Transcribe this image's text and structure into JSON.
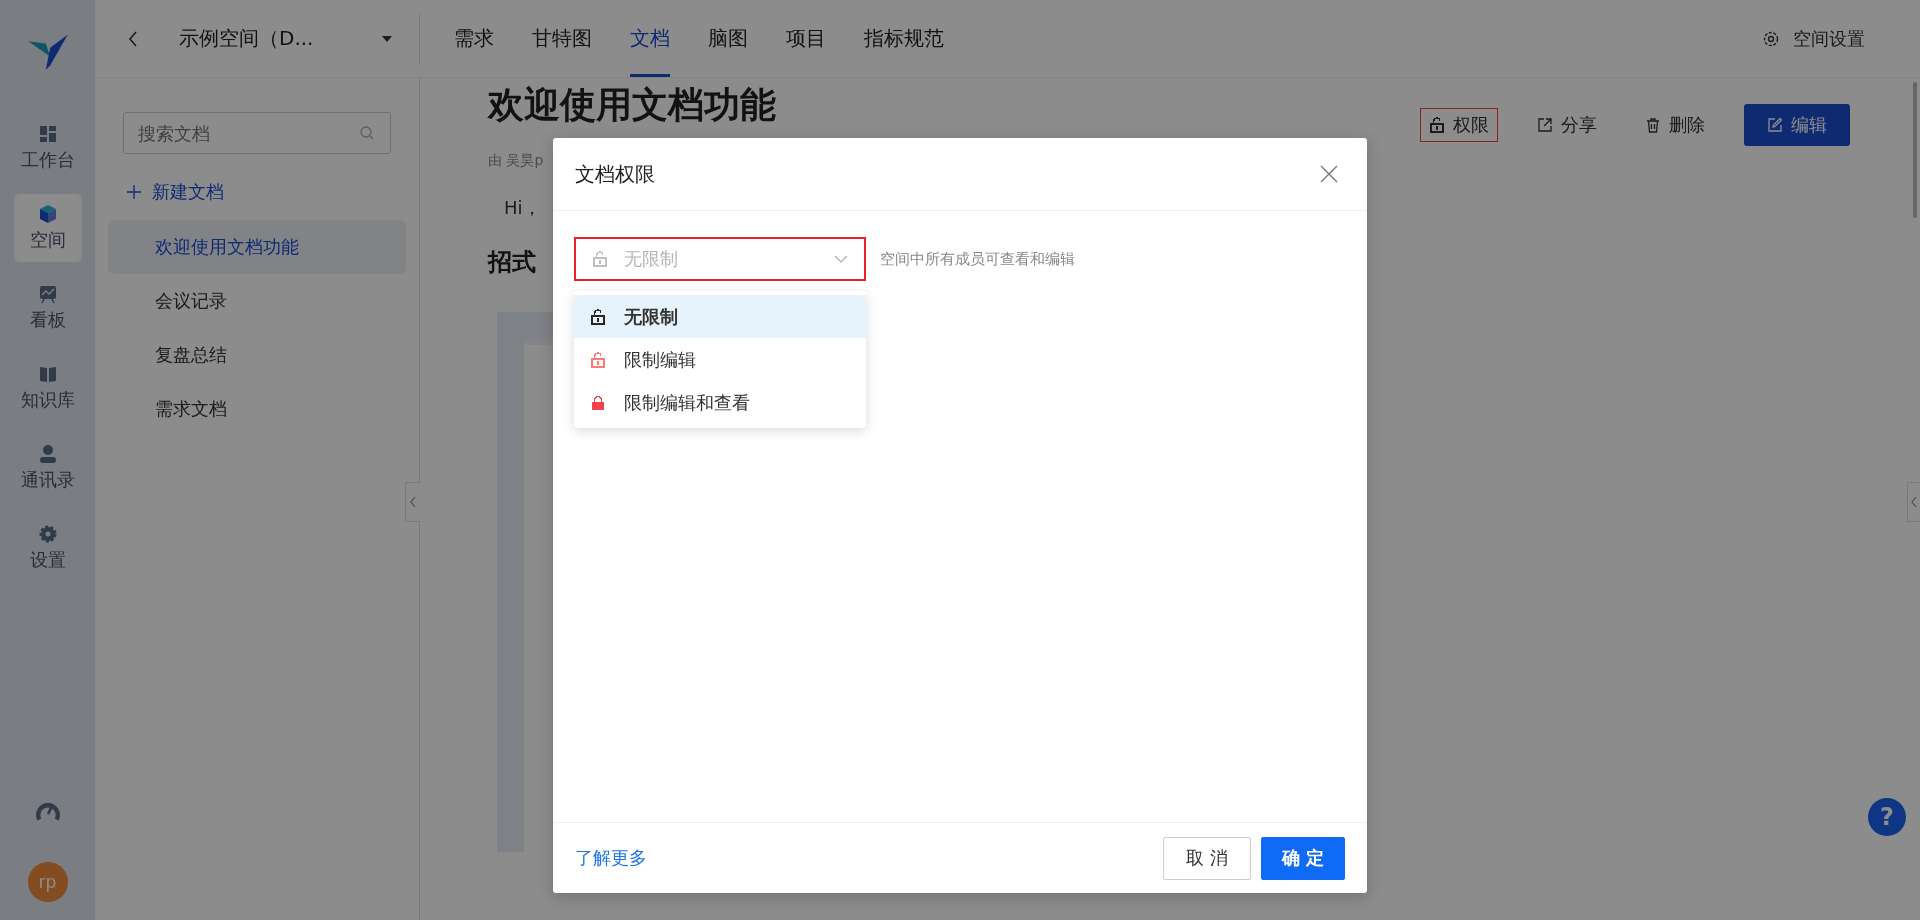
{
  "rail": {
    "items": [
      {
        "label": "工作台",
        "selected": false
      },
      {
        "label": "空间",
        "selected": true
      },
      {
        "label": "看板",
        "selected": false
      },
      {
        "label": "知识库",
        "selected": false
      },
      {
        "label": "通讯录",
        "selected": false
      },
      {
        "label": "设置",
        "selected": false
      }
    ],
    "avatar": "rp"
  },
  "help": "?",
  "header": {
    "space_name": "示例空间（D...",
    "tabs": [
      {
        "label": "需求",
        "selected": false
      },
      {
        "label": "甘特图",
        "selected": false
      },
      {
        "label": "文档",
        "selected": true
      },
      {
        "label": "脑图",
        "selected": false
      },
      {
        "label": "项目",
        "selected": false
      },
      {
        "label": "指标规范",
        "selected": false
      }
    ],
    "settings": "空间设置"
  },
  "doc_sidebar": {
    "search": {
      "placeholder": "搜索文档"
    },
    "new_doc": "新建文档",
    "items": [
      {
        "label": "欢迎使用文档功能",
        "selected": true
      },
      {
        "label": "会议记录",
        "selected": false
      },
      {
        "label": "复盘总结",
        "selected": false
      },
      {
        "label": "需求文档",
        "selected": false
      }
    ]
  },
  "document": {
    "title": "欢迎使用文档功能",
    "meta": "由 吴昊p",
    "greeting": "Hi，",
    "heading": "招式",
    "actions": [
      {
        "label": "权限",
        "kind": "lock",
        "highlighted": true
      },
      {
        "label": "分享",
        "kind": "share",
        "highlighted": false
      },
      {
        "label": "删除",
        "kind": "trash",
        "highlighted": false
      },
      {
        "label": "编辑",
        "kind": "edit",
        "highlighted": false
      }
    ]
  },
  "modal": {
    "title": "文档权限",
    "select": {
      "value": "无限制",
      "highlighted": true,
      "expanded": true
    },
    "description": "空间中所有成员可查看和编辑",
    "options": [
      {
        "label": "无限制",
        "kind": "open",
        "color": "#262626",
        "selected": true
      },
      {
        "label": "限制编辑",
        "kind": "open",
        "color": "#ff7875",
        "selected": false
      },
      {
        "label": "限制编辑和查看",
        "kind": "closed",
        "color": "#f5424b",
        "selected": false
      }
    ],
    "learn_more": "了解更多",
    "buttons": [
      {
        "label": "取 消",
        "kind": "secondary"
      },
      {
        "label": "确 定",
        "kind": "primary"
      }
    ]
  }
}
